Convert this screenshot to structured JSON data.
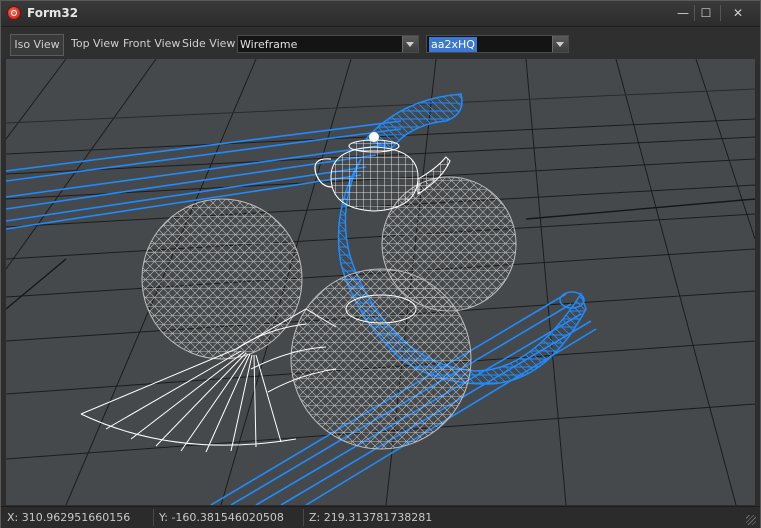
{
  "window": {
    "title": "Form32"
  },
  "toolbar": {
    "iso_view": "Iso View",
    "top_view": "Top View",
    "front_view": "Front View",
    "side_view": "Side View",
    "render_mode": "Wireframe",
    "quality": "aa2xHQ"
  },
  "status": {
    "x": "X: 310.962951660156",
    "y": "Y: -160.381546020508",
    "z": "Z: 219.313781738281"
  },
  "colors": {
    "viewport_bg": "#46494c",
    "grid": "#1a1a1a",
    "blue_wire": "#1e8cff",
    "white_wire": "#ffffff",
    "gray_wire": "#c8c8c8"
  }
}
